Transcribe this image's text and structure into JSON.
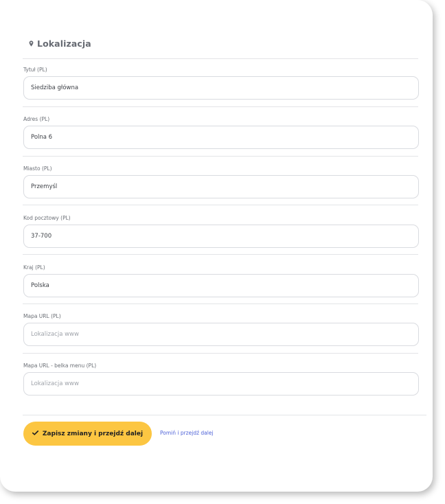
{
  "section": {
    "title": "Lokalizacja",
    "icon": "location-pin-icon"
  },
  "fields": [
    {
      "label": "Tytuł (PL)",
      "value": "Siedziba główna",
      "placeholder": ""
    },
    {
      "label": "Adres (PL)",
      "value": "Polna 6",
      "placeholder": ""
    },
    {
      "label": "Miasto (PL)",
      "value": "Przemyśl",
      "placeholder": ""
    },
    {
      "label": "Kod pocztowy (PL)",
      "value": "37-700",
      "placeholder": ""
    },
    {
      "label": "Kraj (PL)",
      "value": "Polska",
      "placeholder": ""
    },
    {
      "label": "Mapa URL (PL)",
      "value": "",
      "placeholder": "Lokalizacja www"
    },
    {
      "label": "Mapa URL - belka menu (PL)",
      "value": "",
      "placeholder": "Lokalizacja www"
    }
  ],
  "actions": {
    "save_label": "Zapisz zmiany i przejdź dalej",
    "save_icon": "check-icon",
    "skip_label": "Pomiń i przejdź dalej"
  },
  "colors": {
    "accent": "#fcc642",
    "link": "#4f63d8"
  }
}
